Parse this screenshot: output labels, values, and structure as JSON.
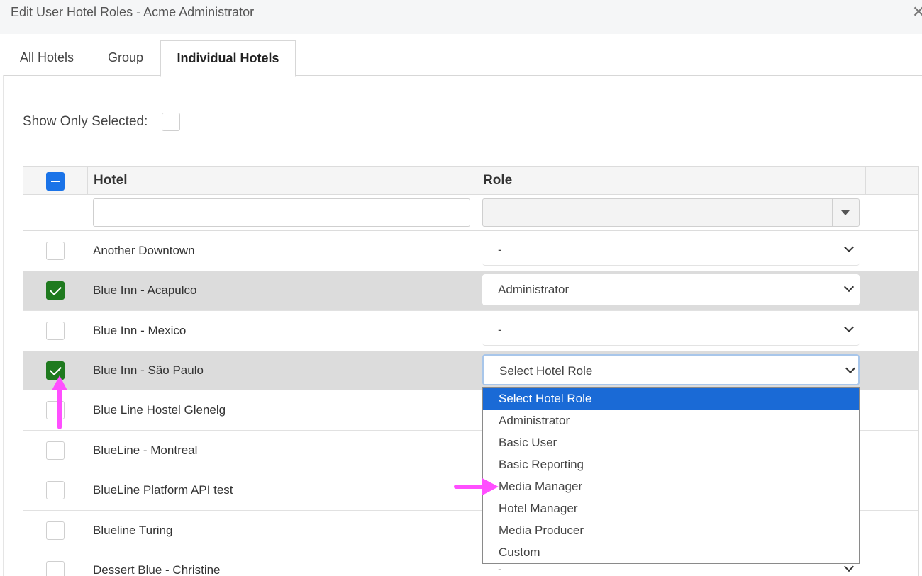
{
  "dialog": {
    "title": "Edit User Hotel Roles - Acme Administrator",
    "close_glyph": "✕"
  },
  "tabs": [
    {
      "label": "All Hotels",
      "active": false
    },
    {
      "label": "Group",
      "active": false
    },
    {
      "label": "Individual Hotels",
      "active": true
    }
  ],
  "filter": {
    "show_only_selected_label": "Show Only Selected:",
    "show_only_selected_checked": false
  },
  "grid": {
    "columns": {
      "hotel": "Hotel",
      "role": "Role"
    },
    "select_all_state": "indeterminate",
    "rows": [
      {
        "hotel": "Another Downtown",
        "role": "-",
        "checked": false
      },
      {
        "hotel": "Blue Inn - Acapulco",
        "role": "Administrator",
        "checked": true
      },
      {
        "hotel": "Blue Inn - Mexico",
        "role": "-",
        "checked": false
      },
      {
        "hotel": "Blue Inn - São Paulo",
        "role": "Select Hotel Role",
        "checked": true
      },
      {
        "hotel": "Blue Line Hostel Glenelg",
        "role": "",
        "checked": false
      },
      {
        "hotel": "BlueLine - Montreal",
        "role": "",
        "checked": false
      },
      {
        "hotel": "BlueLine Platform API test",
        "role": "",
        "checked": false
      },
      {
        "hotel": "Blueline Turing",
        "role": "",
        "checked": false
      },
      {
        "hotel": "Dessert Blue - Christine",
        "role": "-",
        "checked": false
      }
    ]
  },
  "role_dropdown": {
    "highlighted": "Select Hotel Role",
    "options": [
      "Select Hotel Role",
      "Administrator",
      "Basic User",
      "Basic Reporting",
      "Media Manager",
      "Hotel Manager",
      "Media Producer",
      "Custom"
    ]
  },
  "annotations": {
    "arrow_color": "#ff4fff"
  },
  "colors": {
    "checked_green": "#1f7a1f",
    "select_all_blue": "#1a73e8",
    "highlight_blue": "#1a6ad6"
  }
}
